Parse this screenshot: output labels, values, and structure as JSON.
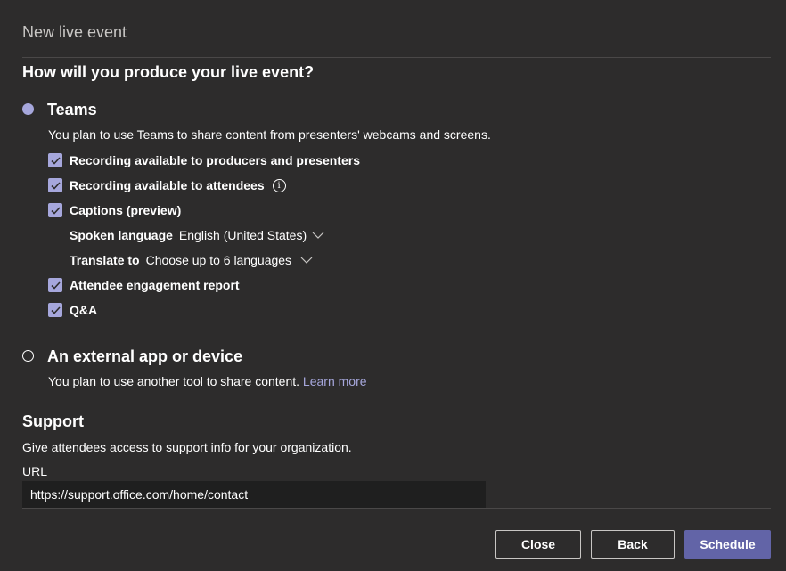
{
  "dialog": {
    "title": "New live event"
  },
  "produce": {
    "heading": "How will you produce your live event?",
    "teams": {
      "title": "Teams",
      "selected": true,
      "description": "You plan to use Teams to share content from presenters' webcams and screens.",
      "options": {
        "recording_producers": {
          "label": "Recording available to producers and presenters",
          "checked": true
        },
        "recording_attendees": {
          "label": "Recording available to attendees",
          "checked": true,
          "icon": "info-icon"
        },
        "captions": {
          "label": "Captions (preview)",
          "checked": true
        },
        "attendee_report": {
          "label": "Attendee engagement report",
          "checked": true
        },
        "qa": {
          "label": "Q&A",
          "checked": true
        }
      },
      "spoken_language": {
        "label": "Spoken language",
        "value": "English (United States)"
      },
      "translate_to": {
        "label": "Translate to",
        "value": "Choose up to 6 languages"
      }
    },
    "external": {
      "title": "An external app or device",
      "selected": false,
      "description": "You plan to use another tool to share content.",
      "link": "Learn more"
    }
  },
  "support": {
    "heading": "Support",
    "description": "Give attendees access to support info for your organization.",
    "url_label": "URL",
    "url_value": "https://support.office.com/home/contact"
  },
  "buttons": {
    "close": "Close",
    "back": "Back",
    "schedule": "Schedule"
  },
  "colors": {
    "background": "#2d2c2c",
    "accent": "#6264a7",
    "accent_light": "#a6a7dc",
    "input_bg": "#1f1f1f"
  }
}
